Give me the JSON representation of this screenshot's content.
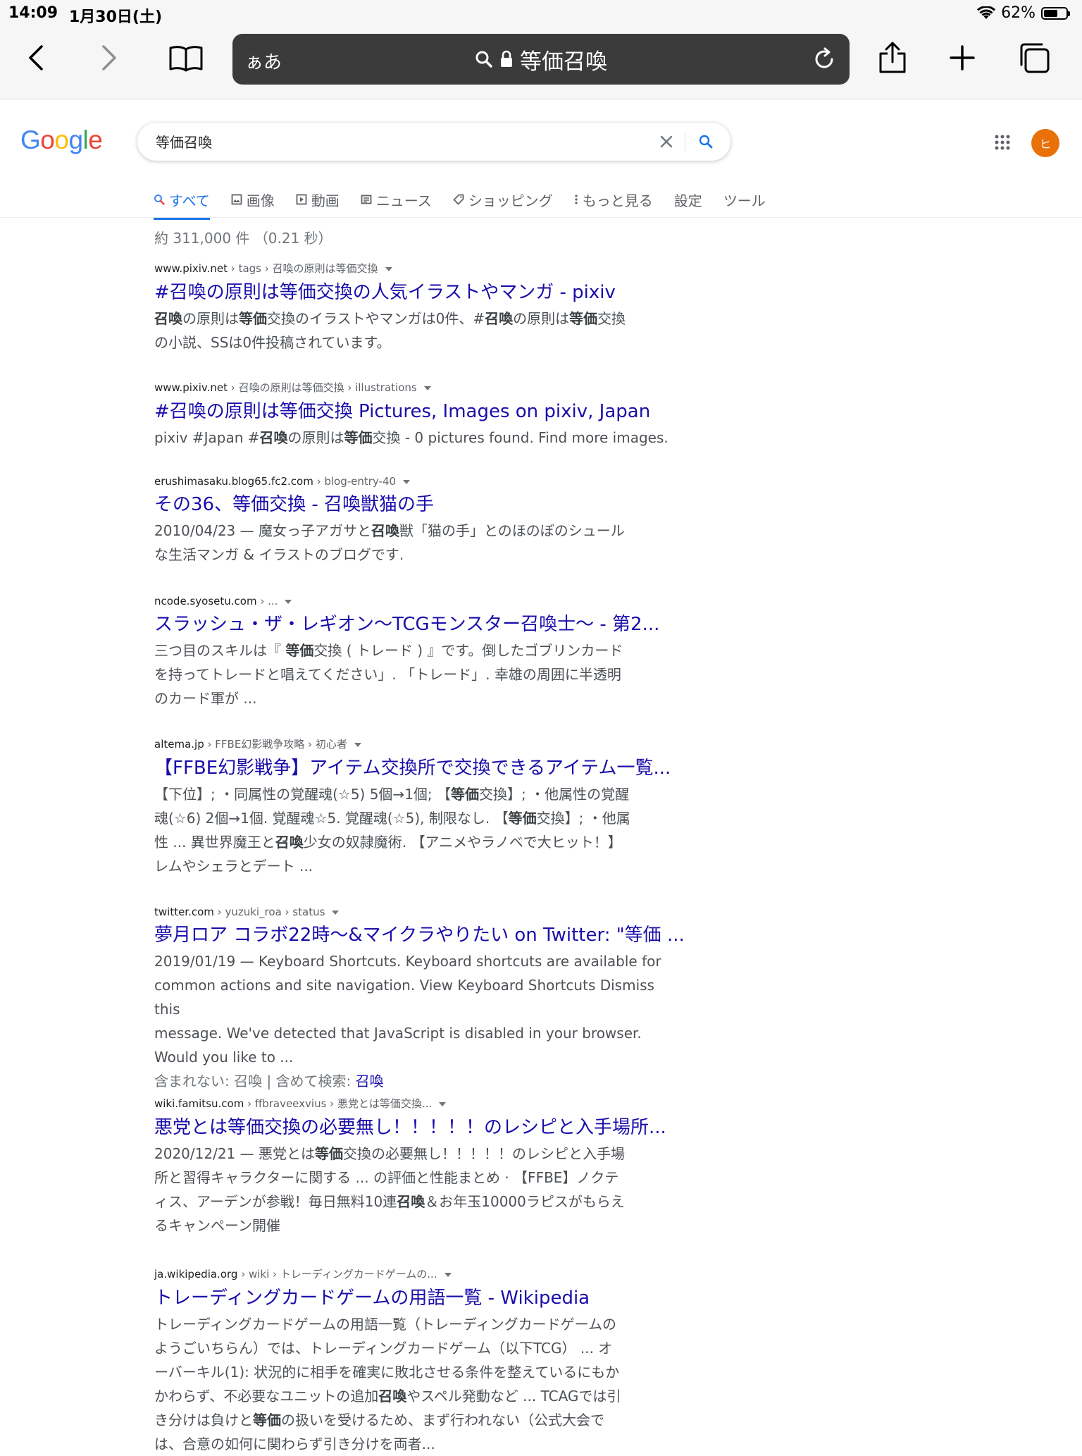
{
  "status": {
    "time": "14:09",
    "date": "1月30日(土)",
    "battery": "62%",
    "battery_level": 0.62
  },
  "browser": {
    "aa_label": "ぁあ",
    "url_text": "等価召喚"
  },
  "google": {
    "logo": "Google",
    "query": "等価召喚",
    "avatar_letter": "ヒ",
    "tabs": [
      "すべて",
      "画像",
      "動画",
      "ニュース",
      "ショッピング",
      "もっと見る",
      "設定",
      "ツール"
    ],
    "stats": "約 311,000 件 （0.21 秒）"
  },
  "colors": {
    "link": "#1a0dab",
    "accent": "#1a73e8",
    "avatar": "#e8710a"
  },
  "results": [
    {
      "domain": "www.pixiv.net",
      "path": " › tags › 召喚の原則は等価交換",
      "title": "#召喚の原則は等価交換の人気イラストやマンガ - pixiv",
      "lines": [
        "召喚の原則は等価交換のイラストやマンガは0件、#召喚の原則は等価交換",
        "の小説、SSは0件投稿されています。"
      ]
    },
    {
      "domain": "www.pixiv.net",
      "path": " › 召喚の原則は等価交換 › illustrations",
      "title": "#召喚の原則は等価交換 Pictures, Images on pixiv, Japan",
      "lines": [
        "pixiv #Japan #召喚の原則は等価交換 - 0 pictures found. Find more images."
      ]
    },
    {
      "domain": "erushimasaku.blog65.fc2.com",
      "path": " › blog-entry-40",
      "title": "その36、等価交換 - 召喚獣猫の手",
      "lines": [
        "2010/04/23 — 魔女っ子アガサと召喚獣「猫の手」とのほのぼのシュール",
        "な生活マンガ & イラストのブログです."
      ]
    },
    {
      "domain": "ncode.syosetu.com",
      "path": " › ...",
      "title": "スラッシュ・ザ・レギオン〜TCGモンスター召喚士〜 - 第2...",
      "lines": [
        "三つ目のスキルは『 等価交換 ( トレード ) 』です。倒したゴブリンカード",
        "を持ってトレードと唱えてください」. 「トレード」. 幸雄の周囲に半透明",
        "のカード軍が ..."
      ]
    },
    {
      "domain": "altema.jp",
      "path": " › FFBE幻影戦争攻略 › 初心者",
      "title": "【FFBE幻影戦争】アイテム交換所で交換できるアイテム一覧...",
      "lines": [
        "【下位】; ・同属性の覚醒魂(☆5) 5個→1個; 【等価交換】; ・他属性の覚醒",
        "魂(☆6) 2個→1個. 覚醒魂☆5. 覚醒魂(☆5), 制限なし. 【等価交換】; ・他属",
        "性 ... 異世界魔王と召喚少女の奴隷魔術. 【アニメやラノベで大ヒット！】",
        "レムやシェラとデート ..."
      ]
    },
    {
      "domain": "twitter.com",
      "path": " › yuzuki_roa › status",
      "title": "夢月ロア コラボ22時〜&マイクラやりたい on Twitter: \"等価 ...",
      "lines": [
        "2019/01/19 — Keyboard Shortcuts. Keyboard shortcuts are available for",
        "common actions and site navigation. View Keyboard Shortcuts Dismiss this",
        "message. We've detected that JavaScript is disabled in your browser.",
        "Would you like to ..."
      ],
      "missing": "含まれない: 召喚 | 含めて検索: ",
      "missing_link": "召喚"
    },
    {
      "domain": "wiki.famitsu.com",
      "path": " › ffbraveexvius › 悪党とは等価交換...",
      "title": "悪党とは等価交換の必要無し！！！！！のレシピと入手場所...",
      "lines": [
        "2020/12/21 — 悪党とは等価交換の必要無し！！！！！のレシピと入手場",
        "所と習得キャラクターに関する ... の評価と性能まとめ · 【FFBE】ノクテ",
        "ィス、アーデンが参戦！毎日無料10連召喚＆お年玉10000ラピスがもらえ",
        "るキャンペーン開催"
      ]
    },
    {
      "domain": "ja.wikipedia.org",
      "path": " › wiki › トレーディングカードゲームの...",
      "title": "トレーディングカードゲームの用語一覧 - Wikipedia",
      "lines": [
        "トレーディングカードゲームの用語一覧（トレーディングカードゲームの",
        "ようごいちらん）では、トレーディングカードゲーム（以下TCG） ... オ",
        "ーバーキル(1): 状況的に相手を確実に敗北させる条件を整えているにもか",
        "かわらず、不必要なユニットの追加召喚やスペル発動など ... TCAGでは引",
        "き分けは負けと等価の扱いを受けるため、まず行われない（公式大会で",
        "は、合意の如何に関わらず引き分けを両者..."
      ]
    }
  ]
}
